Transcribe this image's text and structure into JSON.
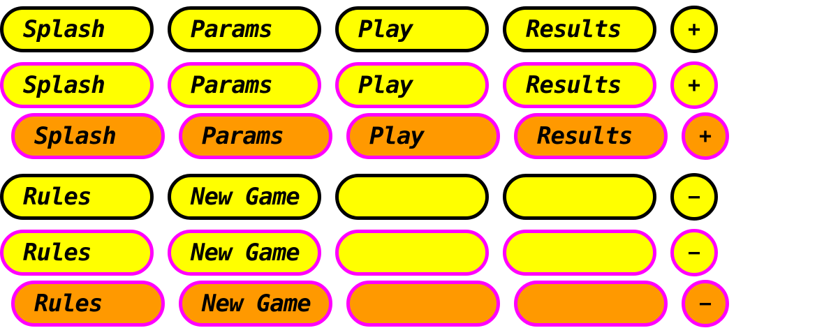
{
  "colors": {
    "button_fill": "#ffff00",
    "button_fill_pressed": "#ff9900",
    "border_normal": "#000000",
    "border_highlight": "#ff00ff",
    "text": "#000000"
  },
  "states": [
    "normal",
    "hover",
    "active"
  ],
  "group_top": {
    "labels": [
      "Splash",
      "Params",
      "Play",
      "Results"
    ],
    "round_button": {
      "label": "+",
      "icon": "plus-icon"
    }
  },
  "group_bottom": {
    "labels": [
      "Rules",
      "New Game",
      "",
      ""
    ],
    "round_button": {
      "label": "−",
      "icon": "minus-icon"
    }
  }
}
